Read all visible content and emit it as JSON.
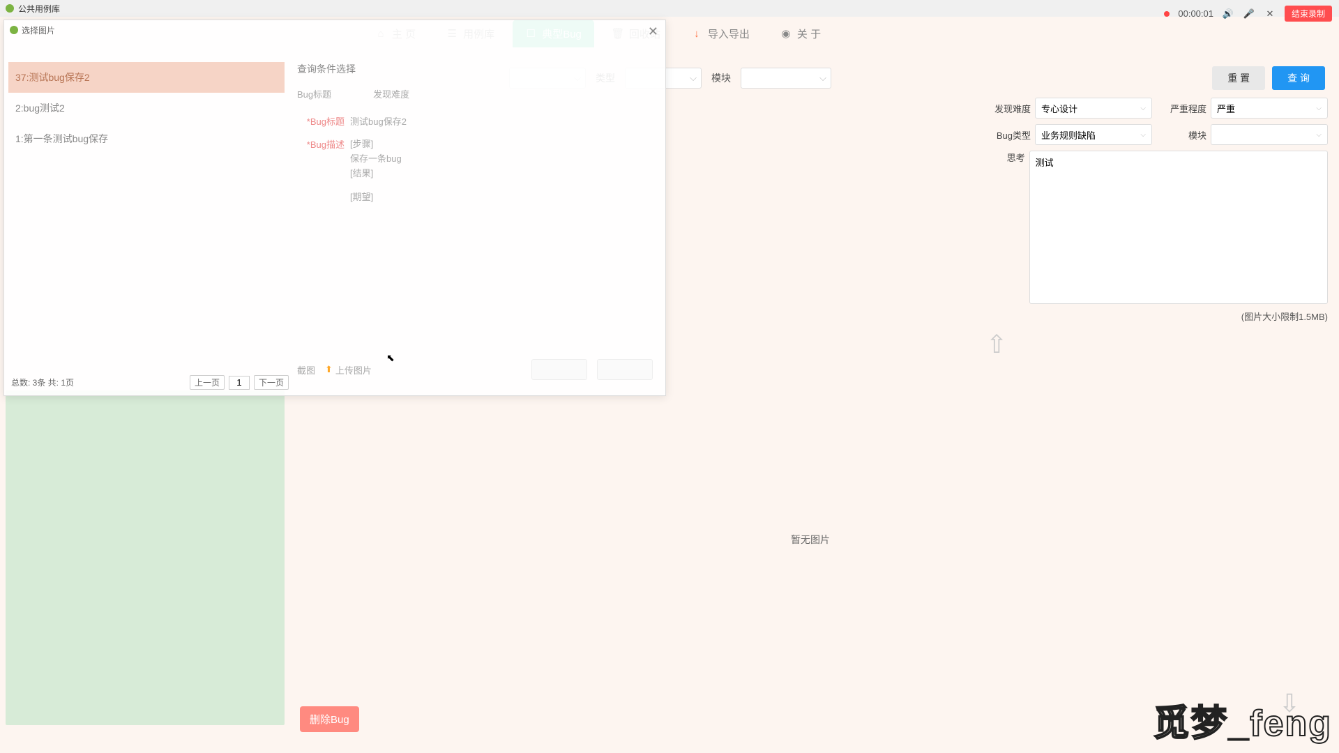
{
  "app": {
    "title": "公共用例库"
  },
  "recorder": {
    "time": "00:00:01",
    "end_label": "结束录制"
  },
  "tabs": {
    "home": "主 页",
    "case_lib": "用例库",
    "typical_bug": "典型Bug",
    "recycle": "回收站",
    "import_export": "导入导出",
    "about": "关 于"
  },
  "filters": {
    "type_label": "类型",
    "module_label": "模块",
    "reset": "重 置",
    "query": "查 询"
  },
  "detail": {
    "discovery_label": "发现难度",
    "discovery_value": "专心设计",
    "severity_label": "严重程度",
    "severity_value": "严重",
    "bug_type_label": "Bug类型",
    "bug_type_value": "业务规则缺陷",
    "module_label": "模块",
    "module_value": "",
    "thinking_label": "思考",
    "thinking_value": "测试",
    "size_note": "(图片大小限制1.5MB)"
  },
  "image_area": {
    "no_image": "暂无图片"
  },
  "buttons": {
    "delete_bug": "删除Bug"
  },
  "watermark": "觅梦_feng",
  "modal": {
    "title": "选择图片",
    "search_section": "查询条件选择",
    "bug_title_filter": "Bug标题",
    "discovery_filter": "发现难度",
    "bug_title_label": "*Bug标题",
    "bug_title_value": "测试bug保存2",
    "bug_desc_label": "*Bug描述",
    "desc_steps": "[步骤]",
    "desc_save": "保存一条bug",
    "desc_result": "[结果]",
    "desc_expect": "[期望]",
    "screenshot": "截图",
    "upload": "上传图片",
    "list": [
      {
        "text": "37:测试bug保存2",
        "selected": true
      },
      {
        "text": "2:bug测试2",
        "selected": false
      },
      {
        "text": "1:第一条测试bug保存",
        "selected": false
      }
    ],
    "pager": {
      "total": "总数: 3条 共: 1页",
      "prev": "上一页",
      "page": "1",
      "next": "下一页"
    }
  }
}
